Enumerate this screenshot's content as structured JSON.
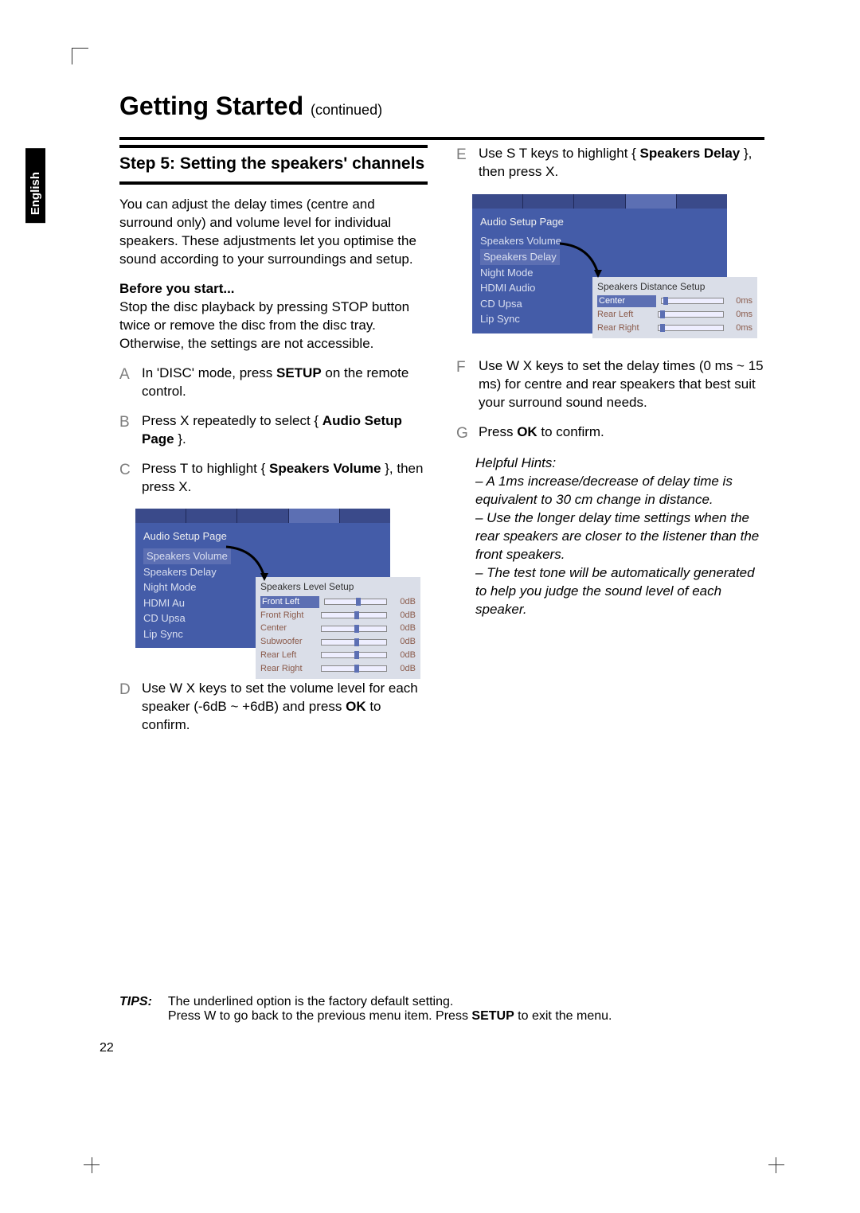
{
  "language_tab": "English",
  "heading": "Getting Started",
  "heading_cont": "(continued)",
  "step_title": "Step 5:  Setting the speakers' channels",
  "intro": "You can adjust the delay times (centre and surround only) and volume level for individual speakers. These adjustments let you optimise the sound according to your surroundings and setup.",
  "before_label": "Before you start...",
  "before_text": "Stop the disc playback by pressing STOP button twice or remove the disc from the disc tray.  Otherwise, the settings are not accessible.",
  "A_pre": "In 'DISC' mode, press ",
  "A_mid": "SETUP",
  "A_post": " on the remote control.",
  "B_pre": "Press  X repeatedly to select { ",
  "B_mid": "Audio Setup Page",
  "B_post": " }.",
  "C_pre": "Press  T to highlight { ",
  "C_mid": "Speakers Volume",
  "C_post": " }, then press  X.",
  "D_pre": "Use  W X keys to set the volume level for each speaker (-6dB ~ +6dB) and press ",
  "D_mid": "OK",
  "D_post": " to confirm.",
  "E_pre": "Use  S T keys to highlight { ",
  "E_mid": "Speakers Delay",
  "E_post": " }, then press  X.",
  "F": "Use  W X keys to set the delay times (0 ms ~ 15 ms) for centre and rear speakers that best suit your surround sound needs.",
  "G_pre": "Press ",
  "G_mid": "OK",
  "G_post": " to confirm.",
  "hints_title": "Helpful Hints:",
  "hint1": "– A 1ms increase/decrease of delay time is equivalent to 30 cm change in distance.",
  "hint2": "– Use the longer delay time settings when the rear speakers are closer to the listener than the front speakers.",
  "hint3": "– The test tone will be automatically generated to help you judge the sound level of each speaker.",
  "menu1": {
    "title": "Audio Setup Page",
    "items": [
      "Speakers Volume",
      "Speakers Delay",
      "Night Mode",
      "HDMI Au",
      "CD Upsa",
      "Lip Sync"
    ],
    "sub_title": "Speakers Level Setup",
    "rows": [
      {
        "lbl": "Front Left",
        "val": "0dB",
        "sel": true
      },
      {
        "lbl": "Front Right",
        "val": "0dB"
      },
      {
        "lbl": "Center",
        "val": "0dB"
      },
      {
        "lbl": "Subwoofer",
        "val": "0dB"
      },
      {
        "lbl": "Rear Left",
        "val": "0dB"
      },
      {
        "lbl": "Rear Right",
        "val": "0dB"
      }
    ]
  },
  "menu2": {
    "title": "Audio Setup Page",
    "items": [
      "Speakers Volume",
      "Speakers Delay",
      "Night Mode",
      "HDMI Audio",
      "CD Upsa",
      "Lip Sync"
    ],
    "sub_title": "Speakers Distance Setup",
    "rows": [
      {
        "lbl": "Center",
        "val": "0ms",
        "sel": true
      },
      {
        "lbl": "Rear Left",
        "val": "0ms"
      },
      {
        "lbl": "Rear Right",
        "val": "0ms"
      }
    ]
  },
  "tips_label": "TIPS:",
  "tips_line1": "The underlined option is the factory default setting.",
  "tips_line2_a": "Press  W to go back to the previous menu item.  Press ",
  "tips_line2_b": "SETUP",
  "tips_line2_c": " to exit the menu.",
  "page_number": "22"
}
